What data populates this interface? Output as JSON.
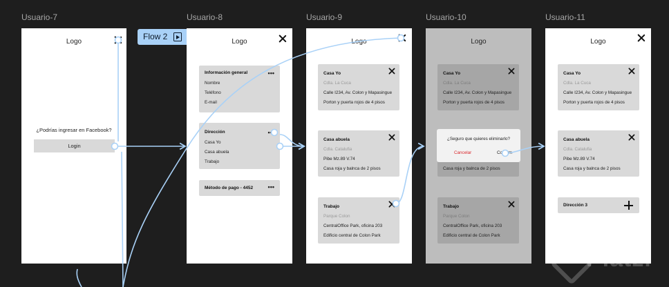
{
  "frames": {
    "u7": {
      "label": "Usuario-7",
      "logo": "Logo",
      "question": "¿Podrías ingresar en Facebook?",
      "login": "Login"
    },
    "u8": {
      "label": "Usuario-8",
      "logo": "Logo",
      "info": {
        "title": "Información general",
        "items": [
          "Nombre",
          "Teléfono",
          "E-mail"
        ]
      },
      "dir": {
        "title": "Dirección",
        "items": [
          "Casa Yo",
          "Casa abuela",
          "Trabajo"
        ]
      },
      "pay": {
        "title": "Método de pago - 4452"
      },
      "dots": "•••"
    },
    "u9": {
      "label": "Usuario-9",
      "logo": "Logo",
      "cards": [
        {
          "title": "Casa Yo",
          "sub": "Cdla. La Cuca",
          "l1": "Calle I234, Av. Colon y Mapasingue",
          "l2": "Porton y puerta rojos de 4 pisos"
        },
        {
          "title": "Casa abuela",
          "sub": "Cdla. Catalufia",
          "l1": "Pibe Mz.89 V.74",
          "l2": "Casa roja y balnca de 2 pisos"
        },
        {
          "title": "Trabajo",
          "sub": "Parque Colon",
          "l1": "CentralOffice Park, oficina 203",
          "l2": "Edificio central de Colon Park"
        }
      ]
    },
    "u10": {
      "label": "Usuario-10",
      "logo": "Logo",
      "cards": [
        {
          "title": "Casa Yo",
          "sub": "Cdla. La Cuca",
          "l1": "Calle I234, Av. Colon y Mapasingue",
          "l2": "Porton y puerta rojos de 4 pisos"
        },
        {
          "l2": "Casa roja y balnca de 2 pisos"
        },
        {
          "title": "Trabajo",
          "sub": "Parque Colon",
          "l1": "CentralOffice Park, oficina 203",
          "l2": "Edificio central de Colon Park"
        }
      ],
      "dialog": {
        "question": "¿Seguro que quieres eliminarlo?",
        "cancel": "Cancelar",
        "confirm": "Confirm"
      }
    },
    "u11": {
      "label": "Usuario-11",
      "logo": "Logo",
      "cards": [
        {
          "title": "Casa Yo",
          "sub": "Cdla. La Cuca",
          "l1": "Calle I234, Av. Colon y Mapasingue",
          "l2": "Porton y puerta rojos de 4 pisos"
        },
        {
          "title": "Casa abuela",
          "sub": "Cdla. Catalufia",
          "l1": "Pibe Mz.89 V.74",
          "l2": "Casa roja y balnca de 2 pisos"
        }
      ],
      "add": "Dirección 3"
    }
  },
  "flow": {
    "label": "Flow 2",
    "icon": "play-frame-icon"
  },
  "watermark": "Platzi",
  "colors": {
    "canvas": "#1e1e1e",
    "wire": "#a9d1f7",
    "card": "#d9d9d9",
    "danger": "#d9262b"
  }
}
